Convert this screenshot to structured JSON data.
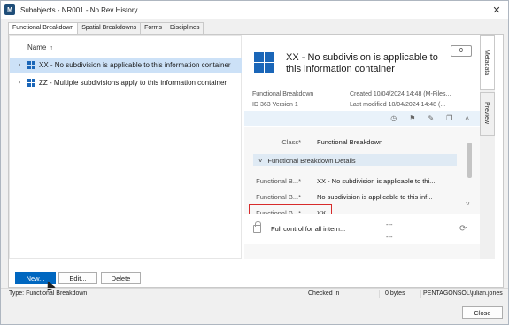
{
  "window": {
    "title": "Subobjects - NR001 - No Rev History",
    "app_icon_letter": "M"
  },
  "tabs": [
    {
      "label": "Functional Breakdown",
      "active": true
    },
    {
      "label": "Spatial Breakdowns",
      "active": false
    },
    {
      "label": "Forms",
      "active": false
    },
    {
      "label": "Disciplines",
      "active": false
    }
  ],
  "list": {
    "header": "Name",
    "sort_indicator": "↑",
    "items": [
      {
        "label": "XX - No subdivision is applicable to this information container",
        "selected": true
      },
      {
        "label": "ZZ - Multiple subdivisions apply to this information container",
        "selected": false
      }
    ]
  },
  "details": {
    "title": "XX - No subdivision is applicable to this information container",
    "comment_count": "0",
    "meta_left": [
      "Functional Breakdown",
      "ID 363  Version 1"
    ],
    "meta_right": [
      "Created 10/04/2024 14:48 (M-Files...",
      "Last modified 10/04/2024 14:48 (..."
    ],
    "class_label": "Class*",
    "class_value": "Functional Breakdown",
    "section_label": "Functional Breakdown Details",
    "properties": [
      {
        "label": "Functional B...*",
        "value": "XX - No subdivision is applicable to thi..."
      },
      {
        "label": "Functional B...*",
        "value": "No subdivision is applicable to this inf..."
      },
      {
        "label": "Functional B...*",
        "value": "XX"
      }
    ],
    "permission_text": "Full control for all intern...",
    "permission_dashes": [
      "---",
      "---"
    ]
  },
  "side_tabs": [
    {
      "label": "Metadata",
      "active": true
    },
    {
      "label": "Preview",
      "active": false
    }
  ],
  "buttons": {
    "new": "New...",
    "edit": "Edit...",
    "delete": "Delete",
    "close": "Close"
  },
  "status": {
    "type": "Type: Functional Breakdown",
    "checked": "Checked In",
    "size": "0 bytes",
    "user": "PENTAGONSOL\\julian.jones"
  },
  "colors": {
    "accent": "#0067c0",
    "selection": "#cce1f7",
    "highlight": "#d72b2b",
    "icon_blue": "#1a66b8"
  }
}
